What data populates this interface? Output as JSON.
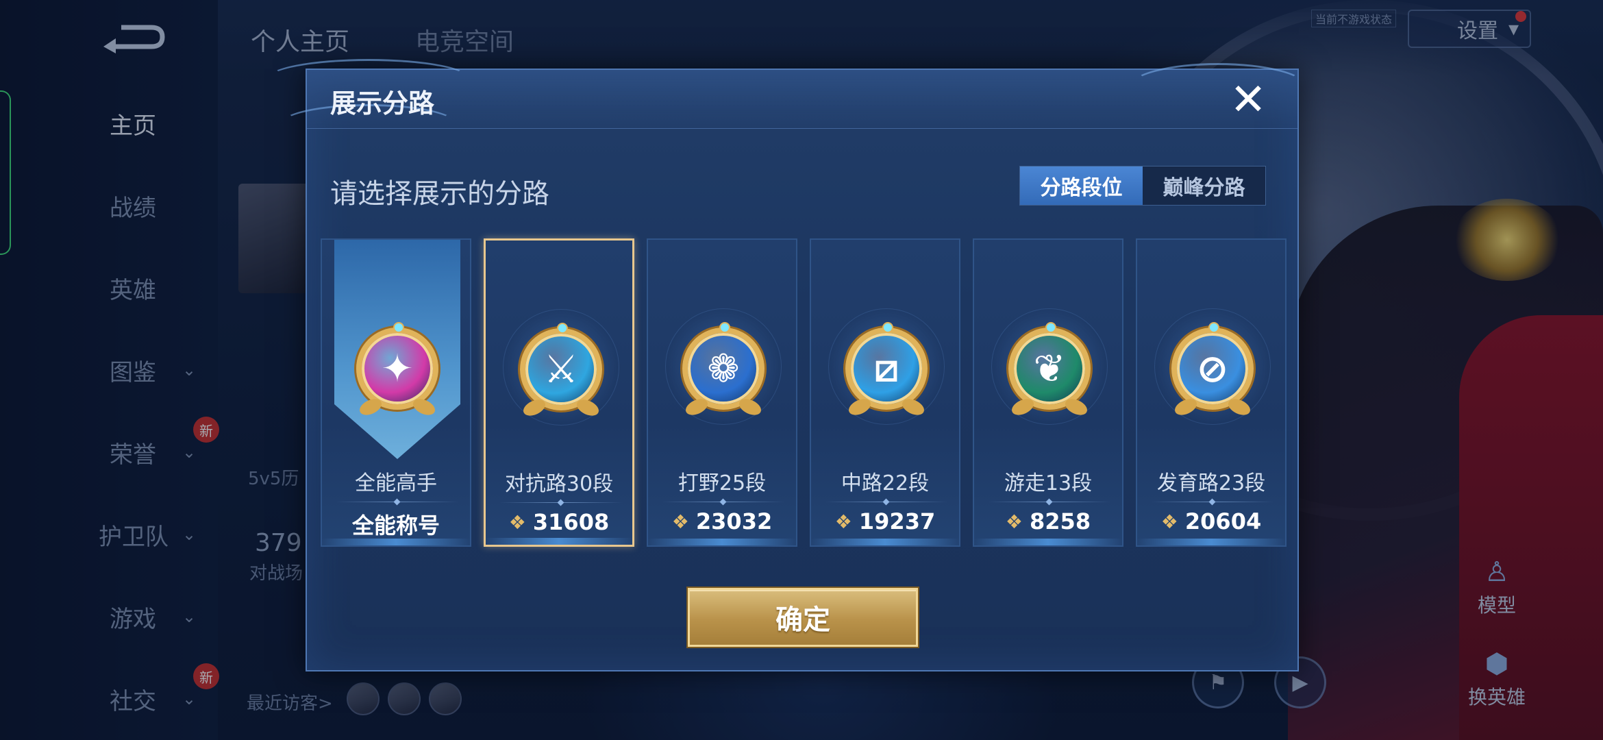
{
  "colors": {
    "modal_bg": "#1c3660",
    "accent_blue": "#336bb8",
    "gold": "#e0b35a",
    "selected_border": "#e8c78e",
    "notif": "#e23a3a"
  },
  "sidebar": {
    "back_icon": "back-arrow-icon",
    "items": [
      {
        "label": "主页",
        "active": true,
        "chevron": false
      },
      {
        "label": "战绩",
        "active": false,
        "chevron": false
      },
      {
        "label": "英雄",
        "active": false,
        "chevron": false
      },
      {
        "label": "图鉴",
        "active": false,
        "chevron": true
      },
      {
        "label": "荣誉",
        "active": false,
        "chevron": true,
        "badge": "新"
      },
      {
        "label": "护卫队",
        "active": false,
        "chevron": true
      },
      {
        "label": "游戏",
        "active": false,
        "chevron": true
      },
      {
        "label": "社交",
        "active": false,
        "chevron": true,
        "badge": "新"
      }
    ]
  },
  "header": {
    "tabs": [
      {
        "label": "个人主页"
      },
      {
        "label": "电竞空间"
      }
    ],
    "online_tag": "当前不游戏状态",
    "settings_label": "设置",
    "settings_chevron": "▾"
  },
  "background": {
    "honor_text": "5v5历",
    "stat_number": "379",
    "stat_label": "对战场",
    "visitors_label": "最近访客>",
    "model_label": "模型",
    "switch_hero_label": "换英雄"
  },
  "modal": {
    "title": "展示分路",
    "close_icon": "close-icon",
    "close_glyph": "✕",
    "prompt": "请选择展示的分路",
    "toggle": [
      {
        "label": "分路段位",
        "active": true
      },
      {
        "label": "巅峰分路",
        "active": false
      }
    ],
    "cards": [
      {
        "name": "全能高手",
        "score": "全能称号",
        "show_score_icon": false,
        "emblem_icon": "all-rounder-emblem-icon",
        "glyph": "✦",
        "color": "#d23aa8",
        "selected": false,
        "banner": true
      },
      {
        "name": "对抗路30段",
        "score": "31608",
        "show_score_icon": true,
        "emblem_icon": "clash-lane-emblem-icon",
        "glyph": "⚔",
        "color": "#2fa6e0",
        "selected": true,
        "banner": false
      },
      {
        "name": "打野25段",
        "score": "23032",
        "show_score_icon": true,
        "emblem_icon": "jungle-emblem-icon",
        "glyph": "❁",
        "color": "#2b6fcf",
        "selected": false,
        "banner": false
      },
      {
        "name": "中路22段",
        "score": "19237",
        "show_score_icon": true,
        "emblem_icon": "mid-lane-emblem-icon",
        "glyph": "⧄",
        "color": "#2fa0e6",
        "selected": false,
        "banner": false
      },
      {
        "name": "游走13段",
        "score": "8258",
        "show_score_icon": true,
        "emblem_icon": "roam-emblem-icon",
        "glyph": "❦",
        "color": "#1f8a6a",
        "selected": false,
        "banner": false
      },
      {
        "name": "发育路23段",
        "score": "20604",
        "show_score_icon": true,
        "emblem_icon": "farm-lane-emblem-icon",
        "glyph": "⊘",
        "color": "#3a8fe0",
        "selected": false,
        "banner": false
      }
    ],
    "score_icon": "peak-points-icon",
    "score_glyph": "❖",
    "confirm_label": "确定"
  }
}
